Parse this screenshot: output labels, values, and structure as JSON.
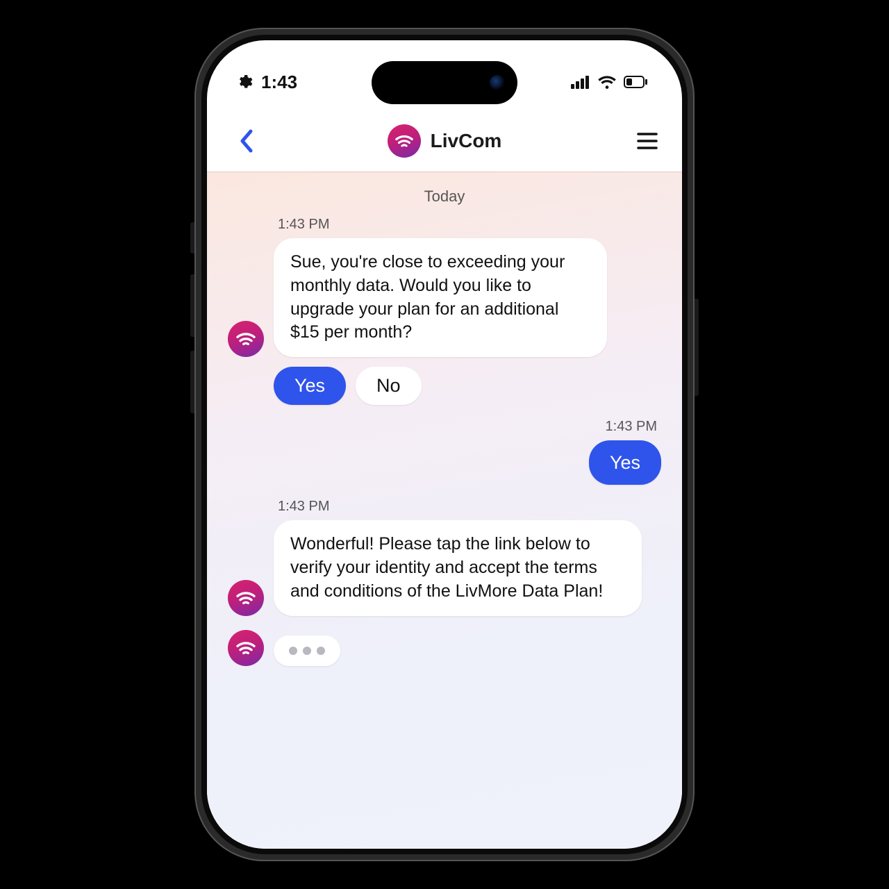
{
  "status": {
    "time": "1:43"
  },
  "header": {
    "title": "LivCom"
  },
  "chat": {
    "day_label": "Today",
    "messages": [
      {
        "role": "bot",
        "time": "1:43 PM",
        "text": "Sue, you're close to exceeding your monthly data. Would you like to upgrade your plan for an additional $15 per month?",
        "quick_replies": [
          {
            "label": "Yes",
            "style": "primary"
          },
          {
            "label": "No",
            "style": "secondary"
          }
        ]
      },
      {
        "role": "user",
        "time": "1:43 PM",
        "text": "Yes"
      },
      {
        "role": "bot",
        "time": "1:43 PM",
        "text": "Wonderful! Please tap the link below to verify your identity and accept the terms and conditions of the LivMore Data Plan!"
      },
      {
        "role": "bot",
        "typing": true
      }
    ]
  },
  "colors": {
    "accent_blue": "#2f54eb",
    "brand_gradient_start": "#d6236e",
    "brand_gradient_end": "#7a2aa8"
  }
}
